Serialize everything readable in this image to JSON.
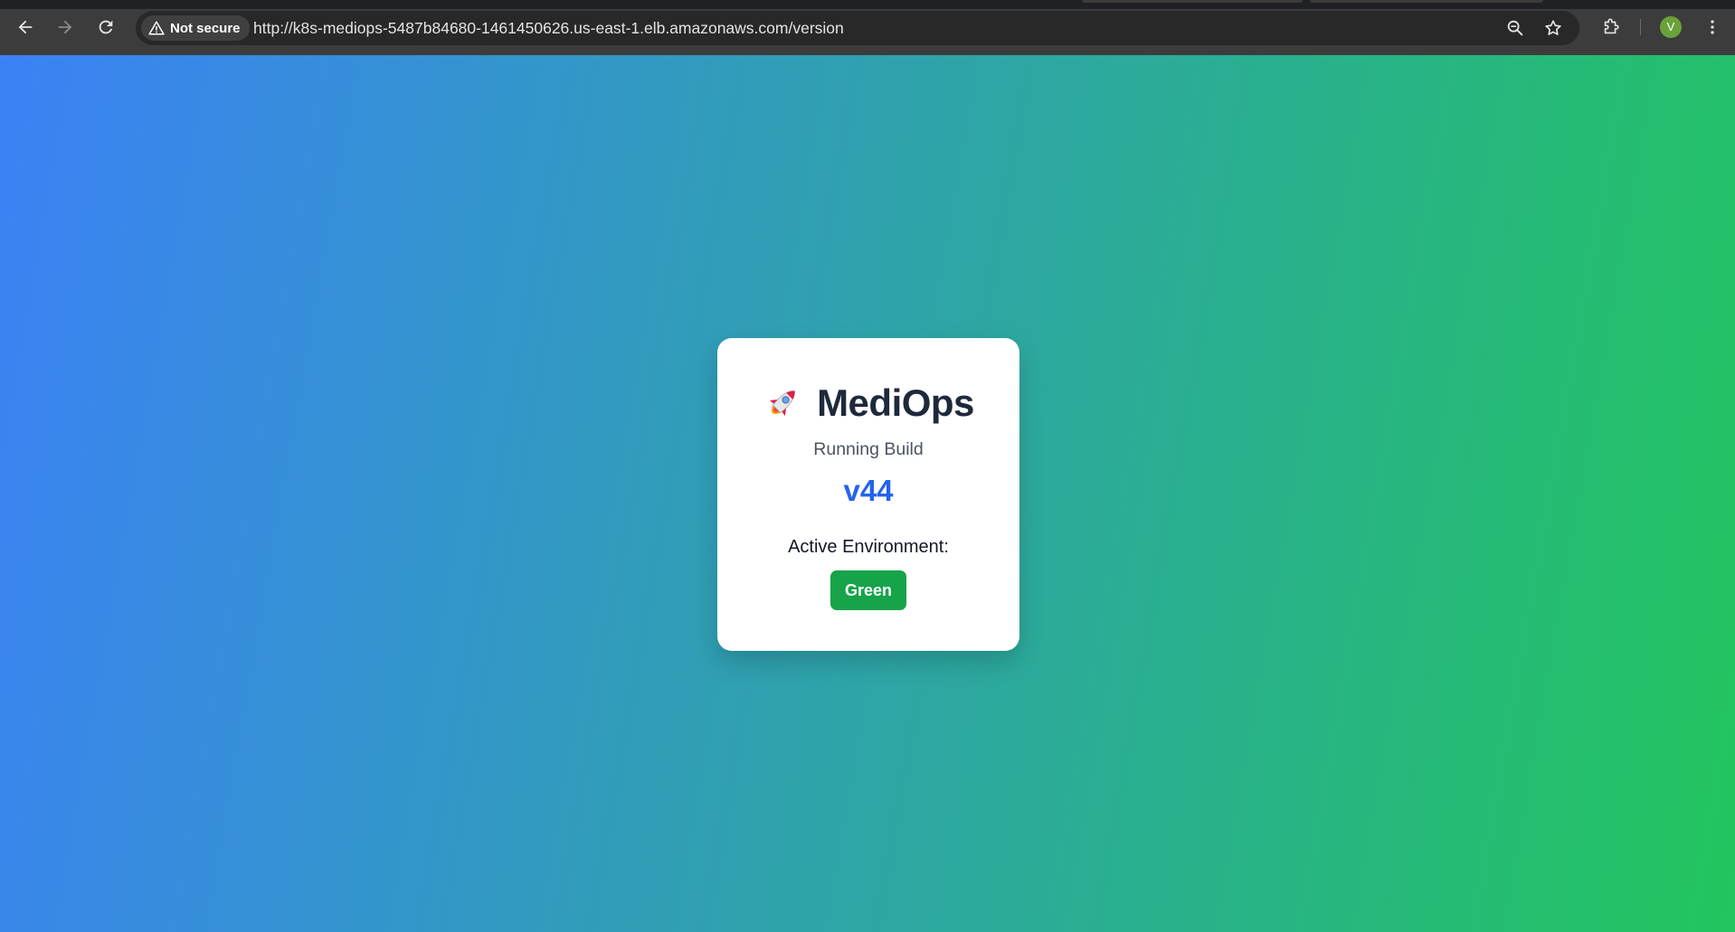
{
  "browser": {
    "security_label": "Not secure",
    "url": "http://k8s-mediops-5487b84680-1461450626.us-east-1.elb.amazonaws.com/version",
    "profile_initial": "V",
    "icons": {
      "back": "arrow-left-icon",
      "forward": "arrow-right-icon",
      "reload": "reload-icon",
      "security": "warning-triangle-icon",
      "zoom": "magnifier-icon",
      "bookmark": "star-icon",
      "extensions": "puzzle-icon",
      "menu": "kebab-menu-icon"
    }
  },
  "page": {
    "colors": {
      "gradient_start": "#3b82f6",
      "gradient_end": "#22c55e",
      "title": "#1e293b",
      "version": "#2563eb",
      "badge": "#16a34a"
    },
    "card": {
      "icon": "rocket-icon",
      "title": "MediOps",
      "subtitle": "Running Build",
      "version": "v44",
      "environment_label": "Active Environment:",
      "environment_value": "Green"
    }
  }
}
